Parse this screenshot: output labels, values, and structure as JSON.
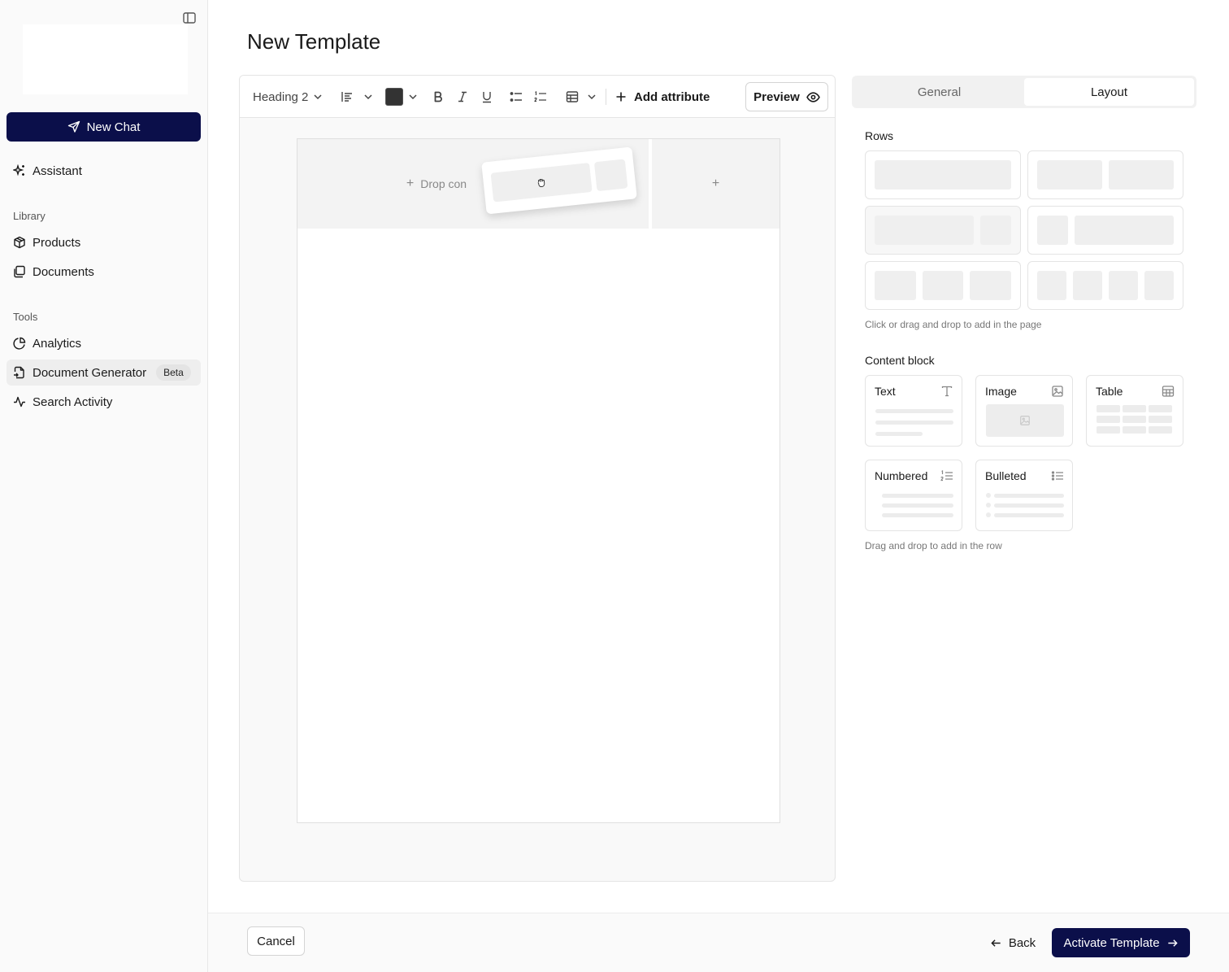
{
  "sidebar": {
    "toggle_icon": "sidebar-toggle-icon",
    "new_chat_label": "New Chat",
    "assistant_label": "Assistant",
    "library_label": "Library",
    "library_items": [
      "Products",
      "Documents"
    ],
    "tools_label": "Tools",
    "tools_items": [
      "Analytics",
      "Document Generator",
      "Search Activity"
    ],
    "beta_label": "Beta",
    "active_item": "Document Generator",
    "accent_color": "#0b0f4a"
  },
  "page": {
    "title": "New Template"
  },
  "toolbar": {
    "heading_select": "Heading 2",
    "text_color": "#333333",
    "add_attribute_label": "Add attribute",
    "preview_label": "Preview"
  },
  "canvas": {
    "drop_text": "Drop con",
    "add_symbol": "+"
  },
  "panel": {
    "tabs": [
      "General",
      "Layout"
    ],
    "active_tab": "Layout",
    "rows_label": "Rows",
    "rows_hint": "Click or drag and drop to add in the page",
    "content_block_label": "Content block",
    "blocks": [
      "Text",
      "Image",
      "Table",
      "Numbered",
      "Bulleted"
    ],
    "blocks_hint": "Drag and drop to add in the row"
  },
  "footer": {
    "cancel_label": "Cancel",
    "back_label": "Back",
    "activate_label": "Activate Template"
  }
}
